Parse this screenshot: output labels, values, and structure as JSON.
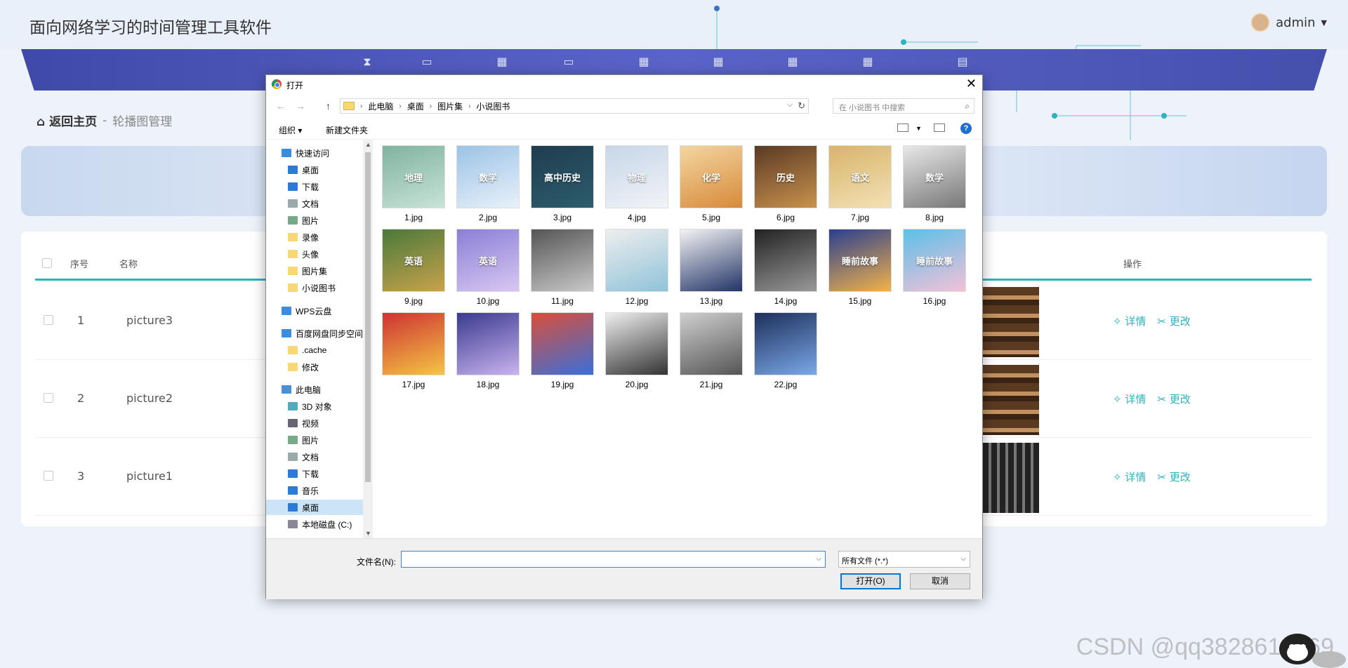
{
  "app": {
    "title": "面向网络学习的时间管理工具软件",
    "user": "admin"
  },
  "breadcrumb": {
    "home": "返回主页",
    "separator": "-",
    "current": "轮播图管理"
  },
  "table": {
    "headers": {
      "index": "序号",
      "name": "名称",
      "actions": "操作"
    },
    "rows": [
      {
        "index": "1",
        "name": "picture3",
        "detail": "详情",
        "edit": "更改"
      },
      {
        "index": "2",
        "name": "picture2",
        "detail": "详情",
        "edit": "更改"
      },
      {
        "index": "3",
        "name": "picture1",
        "detail": "详情",
        "edit": "更改"
      }
    ]
  },
  "dialog": {
    "title": "打开",
    "path": [
      "此电脑",
      "桌面",
      "图片集",
      "小说图书"
    ],
    "search_placeholder": "在 小说图书 中搜索",
    "toolbar": {
      "organize": "组织 ▾",
      "new_folder": "新建文件夹"
    },
    "nav": [
      {
        "label": "快速访问",
        "icon": "star-icon"
      },
      {
        "label": "桌面",
        "icon": "desktop-icon",
        "pinned": true
      },
      {
        "label": "下载",
        "icon": "download-icon",
        "pinned": true
      },
      {
        "label": "文档",
        "icon": "document-icon",
        "pinned": true
      },
      {
        "label": "图片",
        "icon": "picture-icon",
        "pinned": true
      },
      {
        "label": "录像",
        "icon": "folder-icon"
      },
      {
        "label": "头像",
        "icon": "folder-icon"
      },
      {
        "label": "图片集",
        "icon": "folder-icon"
      },
      {
        "label": "小说图书",
        "icon": "folder-icon"
      },
      {
        "label": "WPS云盘",
        "icon": "cloud-icon"
      },
      {
        "label": "百度网盘同步空间",
        "icon": "baidu-icon"
      },
      {
        "label": ".cache",
        "icon": "folder-icon"
      },
      {
        "label": "修改",
        "icon": "folder-icon"
      },
      {
        "label": "此电脑",
        "icon": "computer-icon"
      },
      {
        "label": "3D 对象",
        "icon": "cube-icon"
      },
      {
        "label": "视频",
        "icon": "video-icon"
      },
      {
        "label": "图片",
        "icon": "picture-icon"
      },
      {
        "label": "文档",
        "icon": "document-icon"
      },
      {
        "label": "下载",
        "icon": "download-icon"
      },
      {
        "label": "音乐",
        "icon": "music-icon"
      },
      {
        "label": "桌面",
        "icon": "desktop-icon",
        "selected": true
      },
      {
        "label": "本地磁盘 (C:)",
        "icon": "drive-icon"
      }
    ],
    "files": [
      {
        "name": "1.jpg",
        "cover": "地理"
      },
      {
        "name": "2.jpg",
        "cover": "数学"
      },
      {
        "name": "3.jpg",
        "cover": "高中历史"
      },
      {
        "name": "4.jpg",
        "cover": "物理"
      },
      {
        "name": "5.jpg",
        "cover": "化学"
      },
      {
        "name": "6.jpg",
        "cover": "历史"
      },
      {
        "name": "7.jpg",
        "cover": "语文"
      },
      {
        "name": "8.jpg",
        "cover": "数学"
      },
      {
        "name": "9.jpg",
        "cover": "英语"
      },
      {
        "name": "10.jpg",
        "cover": "英语"
      },
      {
        "name": "11.jpg",
        "cover": ""
      },
      {
        "name": "12.jpg",
        "cover": ""
      },
      {
        "name": "13.jpg",
        "cover": ""
      },
      {
        "name": "14.jpg",
        "cover": ""
      },
      {
        "name": "15.jpg",
        "cover": "睡前故事"
      },
      {
        "name": "16.jpg",
        "cover": "睡前故事"
      },
      {
        "name": "17.jpg",
        "cover": ""
      },
      {
        "name": "18.jpg",
        "cover": ""
      },
      {
        "name": "19.jpg",
        "cover": ""
      },
      {
        "name": "20.jpg",
        "cover": ""
      },
      {
        "name": "21.jpg",
        "cover": ""
      },
      {
        "name": "22.jpg",
        "cover": ""
      }
    ],
    "filename_label": "文件名(N):",
    "filename_value": "",
    "filter": "所有文件 (*.*)",
    "open_button": "打开(O)",
    "cancel_button": "取消"
  },
  "watermark": "CSDN @qq3828614769",
  "colors": {
    "nav_band": "#4a55b5",
    "accent": "#2eb1c0",
    "dialog_focus": "#0078d7"
  }
}
